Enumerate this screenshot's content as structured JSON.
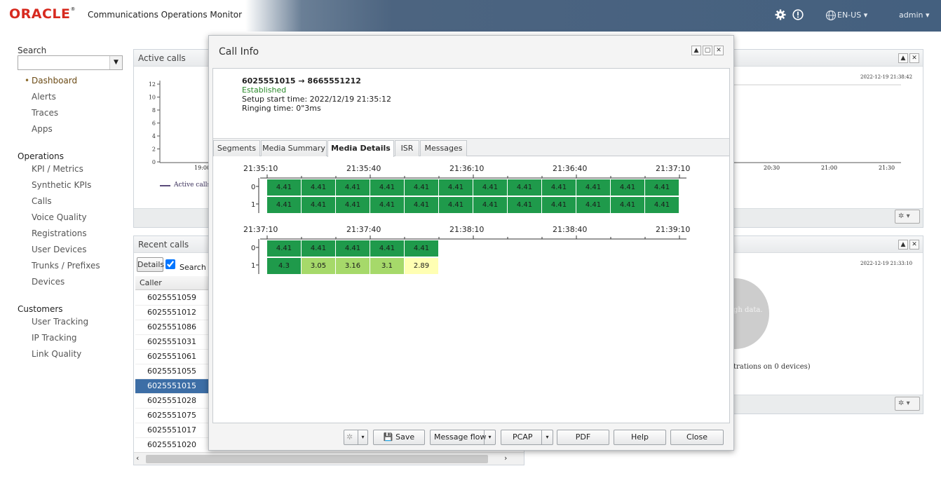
{
  "header": {
    "brand": "ORACLE",
    "product": "Communications Operations Monitor",
    "language": "EN-US",
    "user": "admin",
    "icons": [
      "gear-icon",
      "alert-icon",
      "globe-icon"
    ]
  },
  "sidebar": {
    "search_label": "Search",
    "search_value": "",
    "items_top": [
      {
        "label": "Dashboard",
        "active": true
      },
      {
        "label": "Alerts"
      },
      {
        "label": "Traces"
      },
      {
        "label": "Apps"
      }
    ],
    "operations": {
      "title": "Operations",
      "items": [
        "KPI / Metrics",
        "Synthetic KPIs",
        "Calls",
        "Voice Quality",
        "Registrations",
        "User Devices",
        "Trunks / Prefixes",
        "Devices"
      ]
    },
    "customers": {
      "title": "Customers",
      "items": [
        "User Tracking",
        "IP Tracking",
        "Link Quality"
      ]
    }
  },
  "active_calls": {
    "title": "Active calls",
    "timestamp": "2022-12-19 21:38:42",
    "y_ticks": [
      "12",
      "10",
      "8",
      "6",
      "4",
      "2",
      "0"
    ],
    "x_ticks_left": [
      "19:00"
    ],
    "x_ticks_right": [
      "20:30",
      "21:00",
      "21:30"
    ],
    "legend": "Active calls"
  },
  "recent_calls": {
    "title": "Recent calls",
    "details_label": "Details",
    "search_checkbox_label": "Search o",
    "column_caller": "Caller",
    "rows": [
      "6025551059",
      "6025551012",
      "6025551086",
      "6025551031",
      "6025551061",
      "6025551055",
      "6025551015",
      "6025551028",
      "6025551075",
      "6025551017",
      "6025551020"
    ],
    "selected_index": 6
  },
  "right_panel": {
    "timestamp": "2022-12-19 21:33:10",
    "pie_text": "gh data.",
    "caption": "trations on 0 devices)"
  },
  "dialog": {
    "title": "Call Info",
    "call": {
      "route": "6025551015 → 8665551212",
      "status": "Established",
      "setup": "Setup start time: 2022/12/19 21:35:12",
      "ringing": "Ringing time: 0\"3ms"
    },
    "tabs": [
      "Segments",
      "Media Summary",
      "Media Details",
      "ISR",
      "Messages"
    ],
    "active_tab": 2,
    "media": [
      {
        "ticks": [
          "21:35:10",
          "21:35:40",
          "21:36:10",
          "21:36:40",
          "21:37:10"
        ],
        "rows": [
          {
            "label": "0",
            "values": [
              "4.41",
              "4.41",
              "4.41",
              "4.41",
              "4.41",
              "4.41",
              "4.41",
              "4.41",
              "4.41",
              "4.41",
              "4.41",
              "4.41"
            ]
          },
          {
            "label": "1",
            "values": [
              "4.41",
              "4.41",
              "4.41",
              "4.41",
              "4.41",
              "4.41",
              "4.41",
              "4.41",
              "4.41",
              "4.41",
              "4.41",
              "4.41"
            ]
          }
        ]
      },
      {
        "ticks": [
          "21:37:10",
          "21:37:40",
          "21:38:10",
          "21:38:40",
          "21:39:10"
        ],
        "rows": [
          {
            "label": "0",
            "values": [
              "4.41",
              "4.41",
              "4.41",
              "4.41",
              "4.41"
            ]
          },
          {
            "label": "1",
            "values": [
              "4.3",
              "3.05",
              "3.16",
              "3.1",
              "2.89"
            ]
          }
        ]
      }
    ],
    "colors": {
      "good": "#1f9a4b",
      "fair": "#a6d96a",
      "low": "#ffffb3"
    },
    "buttons": {
      "save": "Save",
      "message_flow": "Message flow",
      "pcap": "PCAP",
      "pdf": "PDF",
      "help": "Help",
      "close": "Close"
    }
  }
}
